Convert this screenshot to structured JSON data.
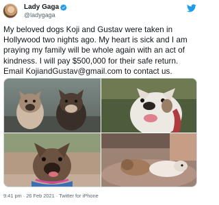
{
  "user": {
    "display_name": "Lady Gaga",
    "handle": "@ladygaga",
    "avatar_icon": "avatar",
    "verified_icon": "verified-badge-icon"
  },
  "tweet": {
    "text": "My beloved dogs Koji and Gustav were taken in Hollywood two nights ago. My heart is sick and I am praying my family will be whole again with an act of kindness. I will pay $500,000 for their safe return. Email KojiandGustav@gmail.com to contact us."
  },
  "media": {
    "photos": [
      "two-french-bulldogs-photo",
      "white-french-bulldog-photo",
      "brindle-french-bulldog-photo",
      "dogs-sleeping-photo"
    ]
  },
  "meta": {
    "time": "9:41 pm",
    "sep1": "·",
    "date": "26 Feb 2021",
    "sep2": "·",
    "source": "Twitter for iPhone"
  },
  "colors": {
    "accent": "#1d9bf0",
    "secondary_text": "#536471"
  }
}
